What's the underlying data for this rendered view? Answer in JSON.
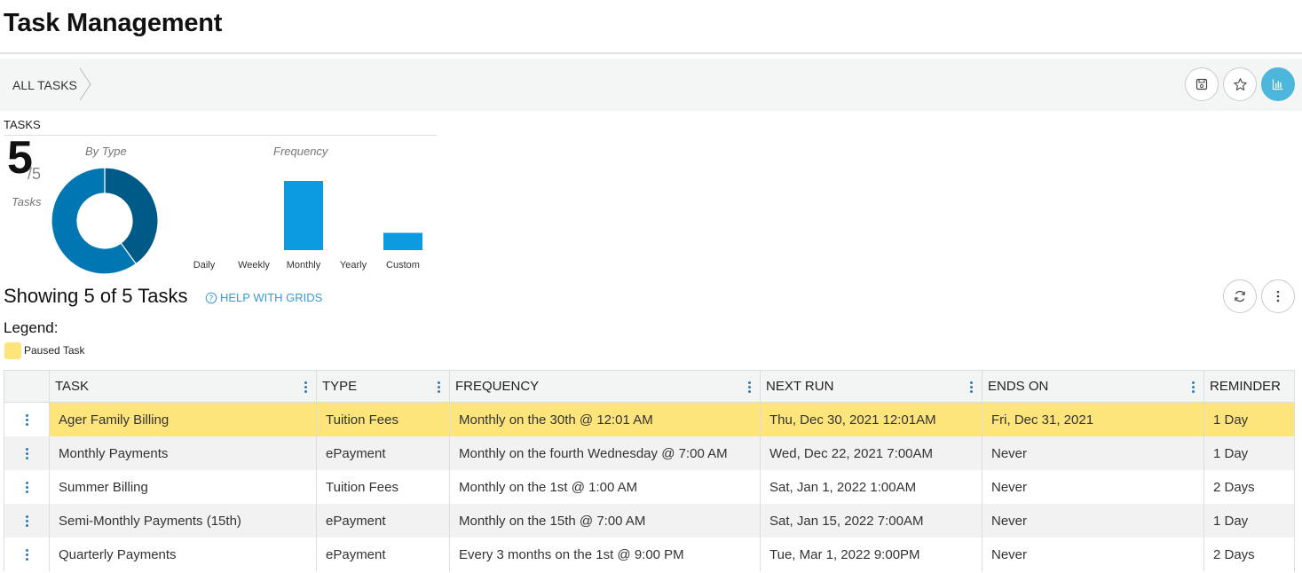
{
  "page": {
    "title": "Task Management"
  },
  "breadcrumb": {
    "label": "ALL TASKS"
  },
  "toolbar": {
    "save_icon": "save-icon",
    "star_icon": "star-icon",
    "chart_icon": "bar-chart-icon"
  },
  "summary": {
    "label": "TASKS",
    "count": "5",
    "total": "/5",
    "unit": "Tasks",
    "by_type_title": "By Type",
    "frequency_title": "Frequency"
  },
  "chart_data": [
    {
      "type": "pie",
      "title": "By Type",
      "categories": [
        "Tuition Fees",
        "ePayment"
      ],
      "values": [
        2,
        3
      ],
      "colors": [
        "#005a87",
        "#0077b2"
      ]
    },
    {
      "type": "bar",
      "title": "Frequency",
      "categories": [
        "Daily",
        "Weekly",
        "Monthly",
        "Yearly",
        "Custom"
      ],
      "values": [
        0,
        0,
        4,
        0,
        1
      ],
      "color": "#0c9be0",
      "ylim": [
        0,
        4
      ]
    }
  ],
  "grid_header": {
    "showing": "Showing 5 of 5 Tasks",
    "help": "HELP WITH GRIDS",
    "legend_label": "Legend:",
    "legend_item": "Paused Task",
    "paused_color": "#fde57c"
  },
  "table": {
    "columns": [
      "TASK",
      "TYPE",
      "FREQUENCY",
      "NEXT RUN",
      "ENDS ON",
      "REMINDER"
    ],
    "rows": [
      {
        "task": "Ager Family Billing",
        "type": "Tuition Fees",
        "frequency": "Monthly on the 30th @ 12:01 AM",
        "next_run": "Thu, Dec 30, 2021 12:01AM",
        "ends_on": "Fri, Dec 31, 2021",
        "reminder": "1 Day"
      },
      {
        "task": "Monthly Payments",
        "type": "ePayment",
        "frequency": "Monthly on the fourth Wednesday @ 7:00 AM",
        "next_run": "Wed, Dec 22, 2021 7:00AM",
        "ends_on": "Never",
        "reminder": "1 Day"
      },
      {
        "task": "Summer Billing",
        "type": "Tuition Fees",
        "frequency": "Monthly on the 1st @ 1:00 AM",
        "next_run": "Sat, Jan 1, 2022 1:00AM",
        "ends_on": "Never",
        "reminder": "2 Days"
      },
      {
        "task": "Semi-Monthly Payments (15th)",
        "type": "ePayment",
        "frequency": "Monthly on the 15th @ 7:00 AM",
        "next_run": "Sat, Jan 15, 2022 7:00AM",
        "ends_on": "Never",
        "reminder": "1 Day"
      },
      {
        "task": "Quarterly Payments",
        "type": "ePayment",
        "frequency": "Every 3 months on the 1st @ 9:00 PM",
        "next_run": "Tue, Mar 1, 2022 9:00PM",
        "ends_on": "Never",
        "reminder": "2 Days"
      }
    ]
  }
}
